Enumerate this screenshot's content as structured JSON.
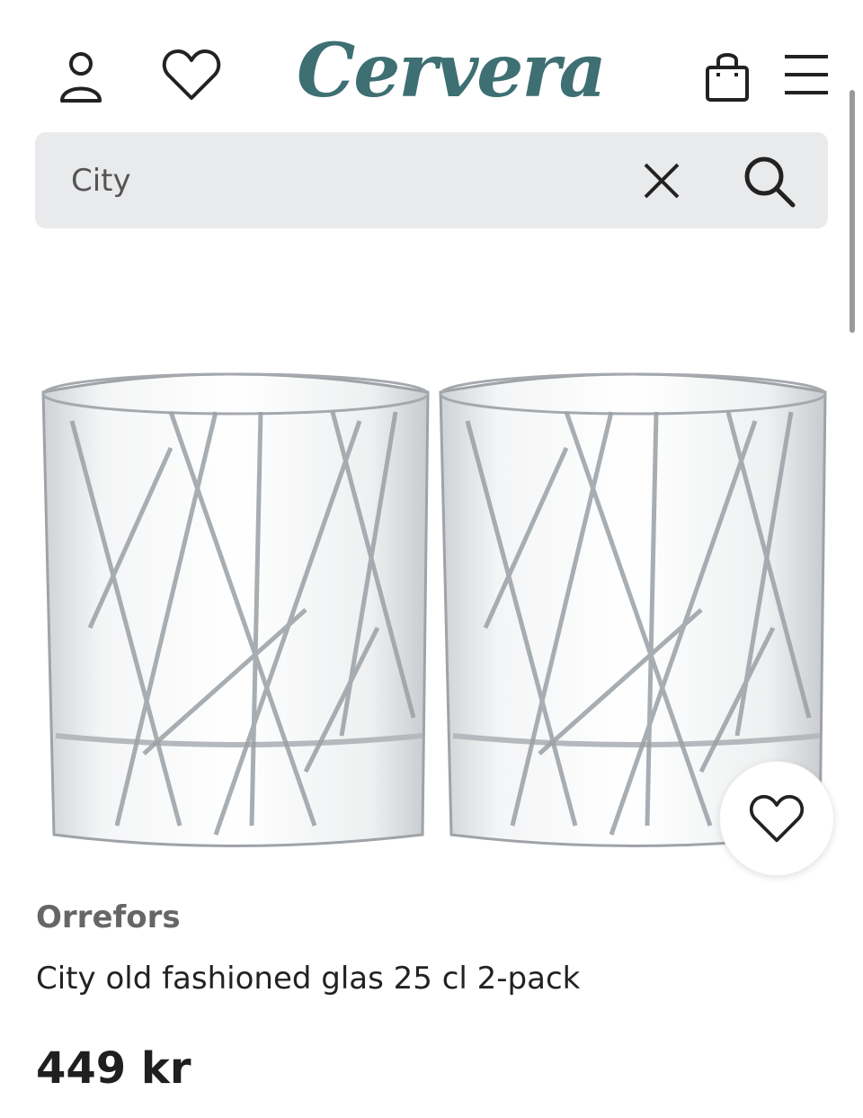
{
  "header": {
    "logo_text": "Cervera",
    "icons": {
      "account": "person-icon",
      "wishlist": "heart-icon",
      "bag": "shopping-bag-icon",
      "menu": "hamburger-menu-icon"
    }
  },
  "search": {
    "value": "City",
    "clear_icon": "close-icon",
    "search_icon": "search-icon"
  },
  "product": {
    "image_alt": "two-cut-crystal-glasses",
    "favorite_icon": "heart-icon",
    "brand": "Orrefors",
    "title": "City old fashioned glas 25 cl 2-pack",
    "price": "449 kr"
  },
  "colors": {
    "brand": "#3e6f72",
    "search_bg": "#e9eaec",
    "text": "#222222",
    "muted": "#666666"
  }
}
